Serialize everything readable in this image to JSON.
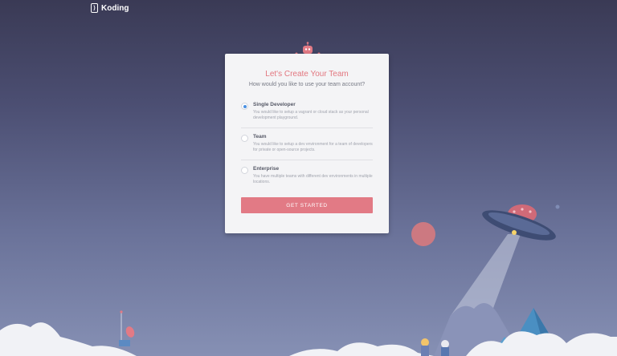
{
  "brand": {
    "logo_glyph": "⟩",
    "name": "Koding"
  },
  "card": {
    "title": "Let's Create Your Team",
    "subtitle": "How would you like to use your team account?",
    "options": [
      {
        "title": "Single Developer",
        "description": "You would like to setup a vagrant or cloud stack as your personal development playground.",
        "selected": true
      },
      {
        "title": "Team",
        "description": "You would like to setup a dev environment for a team of developers for private or open-source projects.",
        "selected": false
      },
      {
        "title": "Enterprise",
        "description": "You have multiple teams with different dev environments in multiple locations.",
        "selected": false
      }
    ],
    "cta_label": "GET STARTED"
  },
  "colors": {
    "accent": "#e27a85",
    "title": "#e2767f",
    "radio_selected": "#4a90e2"
  },
  "illustration": {
    "icons": [
      "robot-mascot-icon",
      "ufo-icon",
      "planet-icon",
      "satellite-dish-icon",
      "astronaut-icon",
      "mountain-icon",
      "cloud-icon"
    ]
  }
}
